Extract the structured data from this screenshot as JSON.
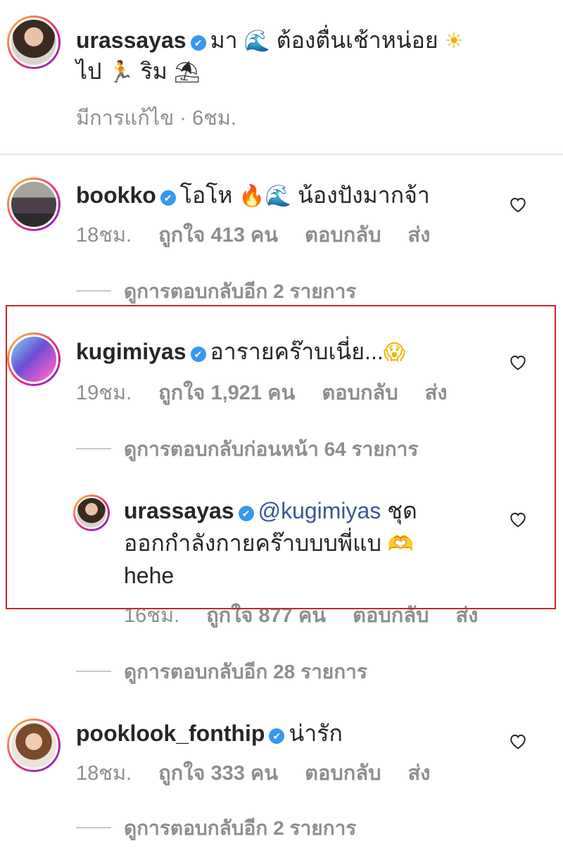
{
  "caption": {
    "username": "urassayas",
    "text_part1": "มา",
    "text_part2": "ต้องตื่นเช้าหน่อย",
    "text_part3": "ไป",
    "text_part4": "ริม",
    "meta_edited": "มีการแก้ไข",
    "meta_time": "6ชม."
  },
  "comments": [
    {
      "username": "bookko",
      "text_part1": "โอโห",
      "text_part2": "น้องปังมากจ้า",
      "time": "18ชม.",
      "likes": "ถูกใจ 413 คน",
      "reply": "ตอบกลับ",
      "send": "ส่ง",
      "view_replies": "ดูการตอบกลับอีก 2 รายการ"
    },
    {
      "username": "kugimiyas",
      "text_part1": "อารายคร๊าบเนี่ย...",
      "time": "19ชม.",
      "likes": "ถูกใจ 1,921 คน",
      "reply": "ตอบกลับ",
      "send": "ส่ง",
      "view_previous": "ดูการตอบกลับก่อนหน้า 64 รายการ"
    },
    {
      "username": "urassayas",
      "mention": "@kugimiyas",
      "text_part1": "ชุด",
      "text_part2": "ออกกำลังกายคร๊าบบบพี่แบ",
      "text_part3": "hehe",
      "time": "16ชม.",
      "likes": "ถูกใจ 877 คน",
      "reply": "ตอบกลับ",
      "send": "ส่ง",
      "view_replies": "ดูการตอบกลับอีก 28 รายการ"
    },
    {
      "username": "pooklook_fonthip",
      "text_part1": "น่ารัก",
      "time": "18ชม.",
      "likes": "ถูกใจ 333 คน",
      "reply": "ตอบกลับ",
      "send": "ส่ง",
      "view_replies": "ดูการตอบกลับอีก 2 รายการ"
    }
  ],
  "icons": {
    "verified": "✔",
    "wave": "🌊",
    "sun": "☀",
    "runner": "🏃",
    "beach": "⛱",
    "fire": "🔥",
    "face": "😱",
    "hands": "🫶"
  },
  "colors": {
    "highlight_border": "#c9262c",
    "verified_blue": "#3897f0",
    "mention_blue": "#385898",
    "meta_gray": "#8e8e8e"
  }
}
